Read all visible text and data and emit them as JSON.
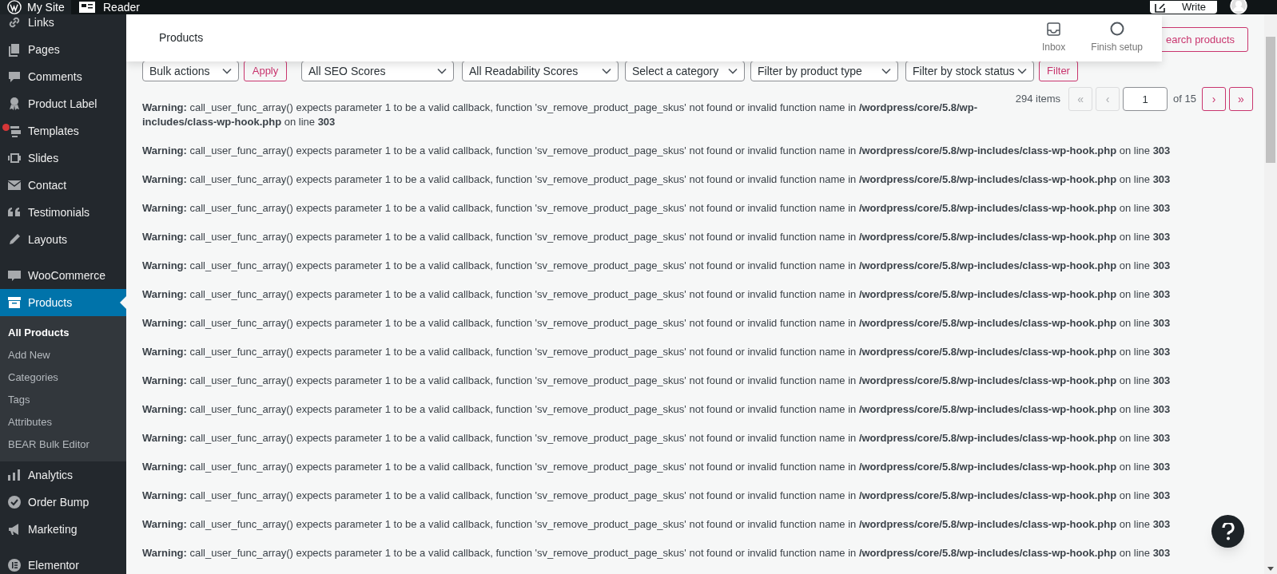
{
  "top_bar": {
    "site": "My Site",
    "reader": "Reader",
    "write": "Write"
  },
  "sidebar": {
    "groups": [
      [
        {
          "label": "Links",
          "selected": false,
          "notification": false
        },
        {
          "label": "Pages",
          "selected": false,
          "notification": false
        },
        {
          "label": "Comments",
          "selected": false,
          "notification": false
        },
        {
          "label": "Product Label",
          "selected": false,
          "notification": false
        },
        {
          "label": "Templates",
          "selected": false,
          "notification": true
        },
        {
          "label": "Slides",
          "selected": false,
          "notification": false
        },
        {
          "label": "Contact",
          "selected": false,
          "notification": false
        },
        {
          "label": "Testimonials",
          "selected": false,
          "notification": false
        },
        {
          "label": "Layouts",
          "selected": false,
          "notification": false
        }
      ],
      [
        {
          "label": "WooCommerce",
          "selected": false,
          "notification": false
        },
        {
          "label": "Products",
          "selected": true,
          "notification": false,
          "children": [
            {
              "label": "All Products",
              "selected": true
            },
            {
              "label": "Add New",
              "selected": false
            },
            {
              "label": "Categories",
              "selected": false
            },
            {
              "label": "Tags",
              "selected": false
            },
            {
              "label": "Attributes",
              "selected": false
            },
            {
              "label": "BEAR Bulk Editor",
              "selected": false
            }
          ]
        },
        {
          "label": "Analytics",
          "selected": false,
          "notification": false
        },
        {
          "label": "Order Bump",
          "selected": false,
          "notification": false
        },
        {
          "label": "Marketing",
          "selected": false,
          "notification": false
        }
      ],
      [
        {
          "label": "Elementor",
          "selected": false,
          "notification": false
        }
      ]
    ]
  },
  "header": {
    "title": "Products",
    "actions": [
      {
        "label": "Inbox"
      },
      {
        "label": "Finish setup"
      }
    ]
  },
  "search_button": "earch products",
  "filters": {
    "bulk_select": "Bulk actions",
    "apply": "Apply",
    "selects": [
      "All SEO Scores",
      "All Readability Scores",
      "Select a category",
      "Filter by product type",
      "Filter by stock status"
    ],
    "filter": "Filter"
  },
  "pagination": {
    "count": "294 items",
    "before": [
      {
        "label": "«",
        "disabled": true
      },
      {
        "label": "‹",
        "disabled": true
      }
    ],
    "page": "1",
    "total": "of 15",
    "after": [
      {
        "label": "›",
        "disabled": false
      },
      {
        "label": "»",
        "disabled": false
      }
    ]
  },
  "warnings": [
    "**Warning:** call_user_func_array() expects parameter 1 to be a valid callback, function 'sv_remove_product_page_skus' not found or invalid function name in **/wordpress/core/5.8/wp-includes/class-wp-hook.php** on line **303**",
    "**Warning:** call_user_func_array() expects parameter 1 to be a valid callback, function 'sv_remove_product_page_skus' not found or invalid function name in **/wordpress/core/5.8/wp-includes/class-wp-hook.php** on line **303**",
    "**Warning:** call_user_func_array() expects parameter 1 to be a valid callback, function 'sv_remove_product_page_skus' not found or invalid function name in **/wordpress/core/5.8/wp-includes/class-wp-hook.php** on line **303**",
    "**Warning:** call_user_func_array() expects parameter 1 to be a valid callback, function 'sv_remove_product_page_skus' not found or invalid function name in **/wordpress/core/5.8/wp-includes/class-wp-hook.php** on line **303**",
    "**Warning:** call_user_func_array() expects parameter 1 to be a valid callback, function 'sv_remove_product_page_skus' not found or invalid function name in **/wordpress/core/5.8/wp-includes/class-wp-hook.php** on line **303**",
    "**Warning:** call_user_func_array() expects parameter 1 to be a valid callback, function 'sv_remove_product_page_skus' not found or invalid function name in **/wordpress/core/5.8/wp-includes/class-wp-hook.php** on line **303**",
    "**Warning:** call_user_func_array() expects parameter 1 to be a valid callback, function 'sv_remove_product_page_skus' not found or invalid function name in **/wordpress/core/5.8/wp-includes/class-wp-hook.php** on line **303**",
    "**Warning:** call_user_func_array() expects parameter 1 to be a valid callback, function 'sv_remove_product_page_skus' not found or invalid function name in **/wordpress/core/5.8/wp-includes/class-wp-hook.php** on line **303**",
    "**Warning:** call_user_func_array() expects parameter 1 to be a valid callback, function 'sv_remove_product_page_skus' not found or invalid function name in **/wordpress/core/5.8/wp-includes/class-wp-hook.php** on line **303**",
    "**Warning:** call_user_func_array() expects parameter 1 to be a valid callback, function 'sv_remove_product_page_skus' not found or invalid function name in **/wordpress/core/5.8/wp-includes/class-wp-hook.php** on line **303**",
    "**Warning:** call_user_func_array() expects parameter 1 to be a valid callback, function 'sv_remove_product_page_skus' not found or invalid function name in **/wordpress/core/5.8/wp-includes/class-wp-hook.php** on line **303**",
    "**Warning:** call_user_func_array() expects parameter 1 to be a valid callback, function 'sv_remove_product_page_skus' not found or invalid function name in **/wordpress/core/5.8/wp-includes/class-wp-hook.php** on line **303**",
    "**Warning:** call_user_func_array() expects parameter 1 to be a valid callback, function 'sv_remove_product_page_skus' not found or invalid function name in **/wordpress/core/5.8/wp-includes/class-wp-hook.php** on line **303**",
    "**Warning:** call_user_func_array() expects parameter 1 to be a valid callback, function 'sv_remove_product_page_skus' not found or invalid function name in **/wordpress/core/5.8/wp-includes/class-wp-hook.php** on line **303**",
    "**Warning:** call_user_func_array() expects parameter 1 to be a valid callback, function 'sv_remove_product_page_skus' not found or invalid function name in **/wordpress/core/5.8/wp-includes/class-wp-hook.php** on line **303**",
    "**Warning:** call_user_func_array() expects parameter 1 to be a valid callback, function 'sv_remove_product_page_skus' not found or invalid function name in **/wordpress/core/5.8/wp-includes/class-wp-hook.php** on line **303**"
  ]
}
